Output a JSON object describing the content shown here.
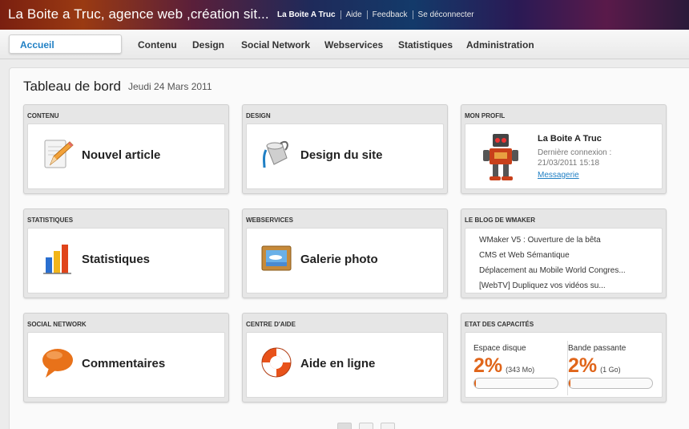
{
  "header": {
    "site_title": "La Boite a Truc, agence web ,création sit...",
    "user": "La Boite A Truc",
    "links": [
      "Aide",
      "Feedback",
      "Se déconnecter"
    ]
  },
  "nav": {
    "home": "Accueil",
    "items": [
      "Contenu",
      "Design",
      "Social Network",
      "Webservices",
      "Statistiques",
      "Administration"
    ]
  },
  "dashboard": {
    "title": "Tableau de bord",
    "date": "Jeudi 24 Mars 2011"
  },
  "widgets": {
    "contenu": {
      "title": "CONTENU",
      "label": "Nouvel article",
      "icon": "pencil-document-icon"
    },
    "design": {
      "title": "DESIGN",
      "label": "Design du site",
      "icon": "paint-bucket-icon"
    },
    "profil": {
      "title": "MON PROFIL",
      "name": "La Boite A Truc",
      "last_login": "Dernière connexion : 21/03/2011 15:18",
      "messages": "Messagerie",
      "icon": "robot-avatar-icon"
    },
    "stats": {
      "title": "STATISTIQUES",
      "label": "Statistiques",
      "icon": "bar-chart-icon"
    },
    "webservices": {
      "title": "WEBSERVICES",
      "label": "Galerie photo",
      "icon": "photo-frame-icon"
    },
    "blog": {
      "title": "LE BLOG DE WMAKER",
      "posts": [
        "WMaker V5 : Ouverture de la bêta",
        "CMS et Web Sémantique",
        "Déplacement au Mobile World Congres...",
        "[WebTV] Dupliquez vos vidéos su..."
      ]
    },
    "social": {
      "title": "SOCIAL NETWORK",
      "label": "Commentaires",
      "icon": "speech-bubble-icon"
    },
    "aide": {
      "title": "CENTRE D'AIDE",
      "label": "Aide en ligne",
      "icon": "lifebuoy-icon"
    },
    "capacites": {
      "title": "ETAT DES CAPACITÉS",
      "disk": {
        "label": "Espace disque",
        "percent": "2%",
        "total": "(343 Mo)",
        "fill": 0.02
      },
      "bandwidth": {
        "label": "Bande passante",
        "percent": "2%",
        "total": "(1 Go)",
        "fill": 0.02
      }
    }
  },
  "colors": {
    "accent": "#1f7fc4",
    "capacity": "#e0651a"
  }
}
